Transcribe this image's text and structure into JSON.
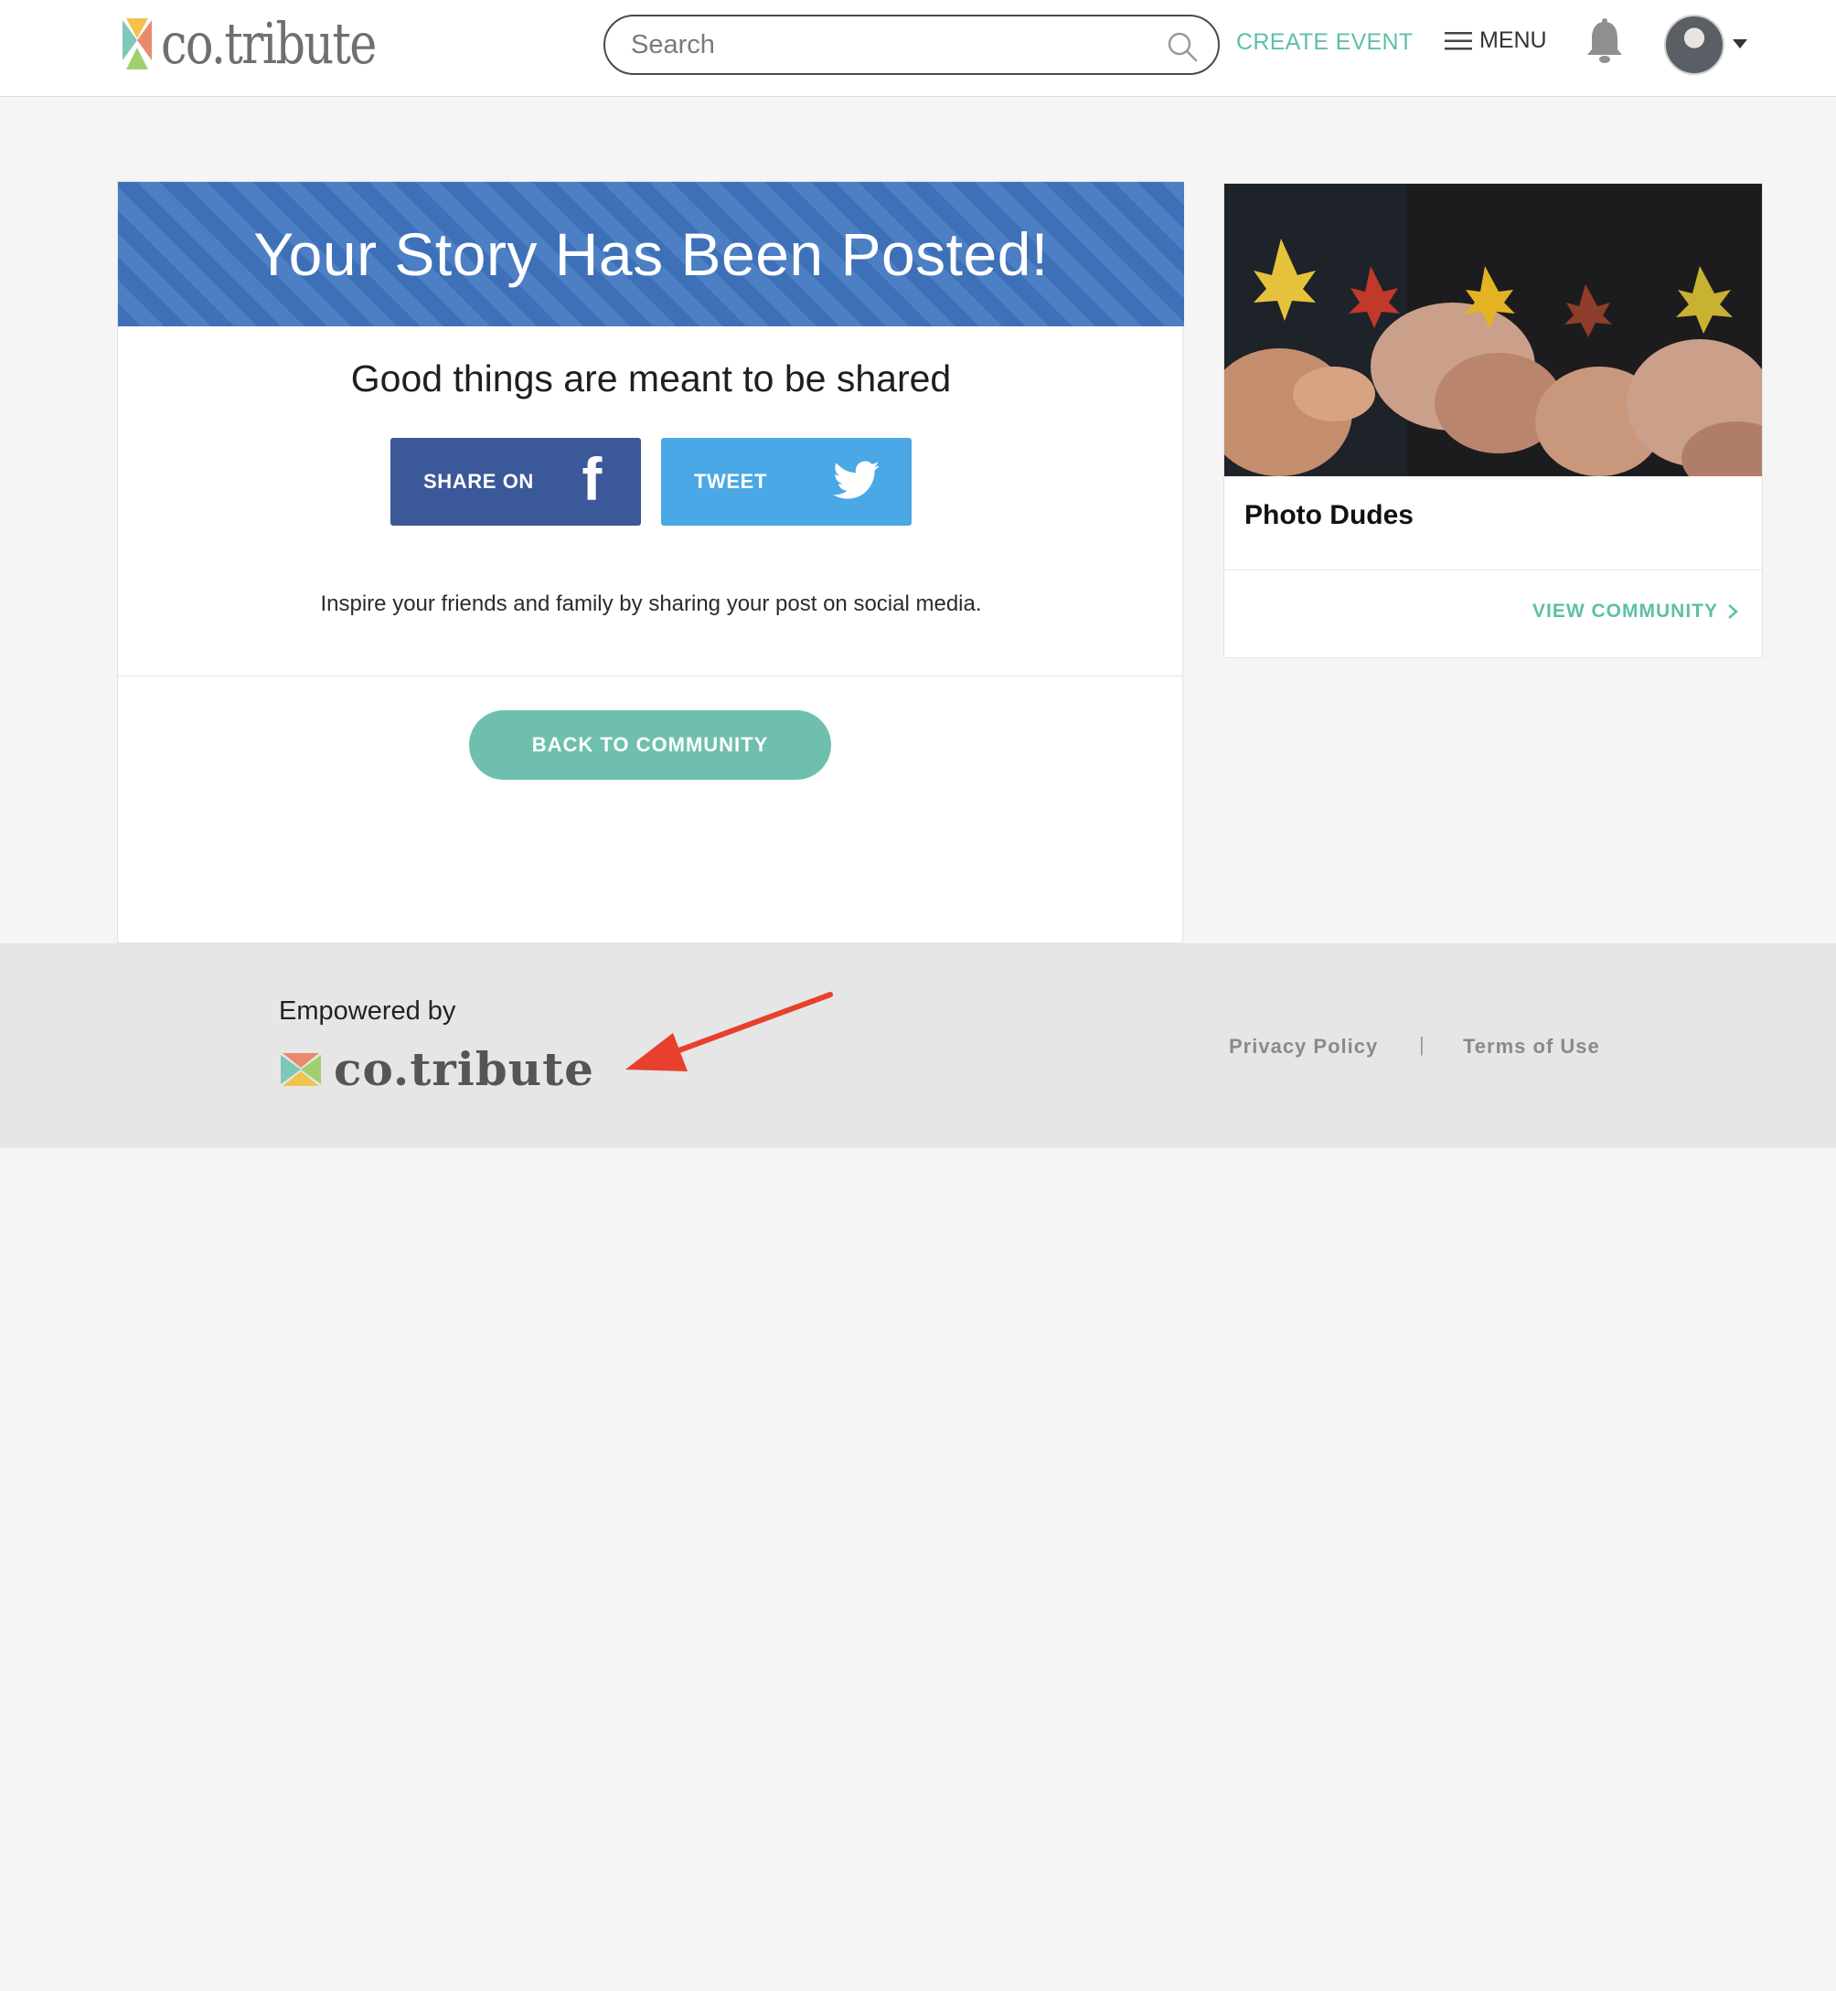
{
  "header": {
    "logo_text": "co.tribute",
    "search_placeholder": "Search",
    "create_event": "CREATE EVENT",
    "menu_label": "MENU"
  },
  "main": {
    "banner_title": "Your Story Has Been Posted!",
    "subtitle": "Good things are meant to be shared",
    "share_facebook_label": "SHARE ON",
    "tweet_label": "TWEET",
    "inspire_text": "Inspire your friends and family by sharing your post on social media.",
    "back_button": "BACK TO COMMUNITY"
  },
  "side_card": {
    "community_name": "Photo Dudes",
    "view_community": "VIEW COMMUNITY"
  },
  "footer": {
    "empowered_by": "Empowered by",
    "logo_text": "co.tribute",
    "privacy_policy": "Privacy Policy",
    "separator": "|",
    "terms_of_use": "Terms of Use"
  },
  "colors": {
    "accent_teal": "#5dbfa7",
    "facebook_blue": "#3b5998",
    "twitter_blue": "#4aa8e6",
    "banner_blue": "#3e70b8",
    "annotation_red": "#e8402e"
  },
  "icons": [
    "logo-mark-icon",
    "search-icon",
    "hamburger-icon",
    "bell-icon",
    "caret-down-icon",
    "facebook-icon",
    "twitter-icon",
    "chevron-right-icon",
    "red-arrow-annotation"
  ]
}
